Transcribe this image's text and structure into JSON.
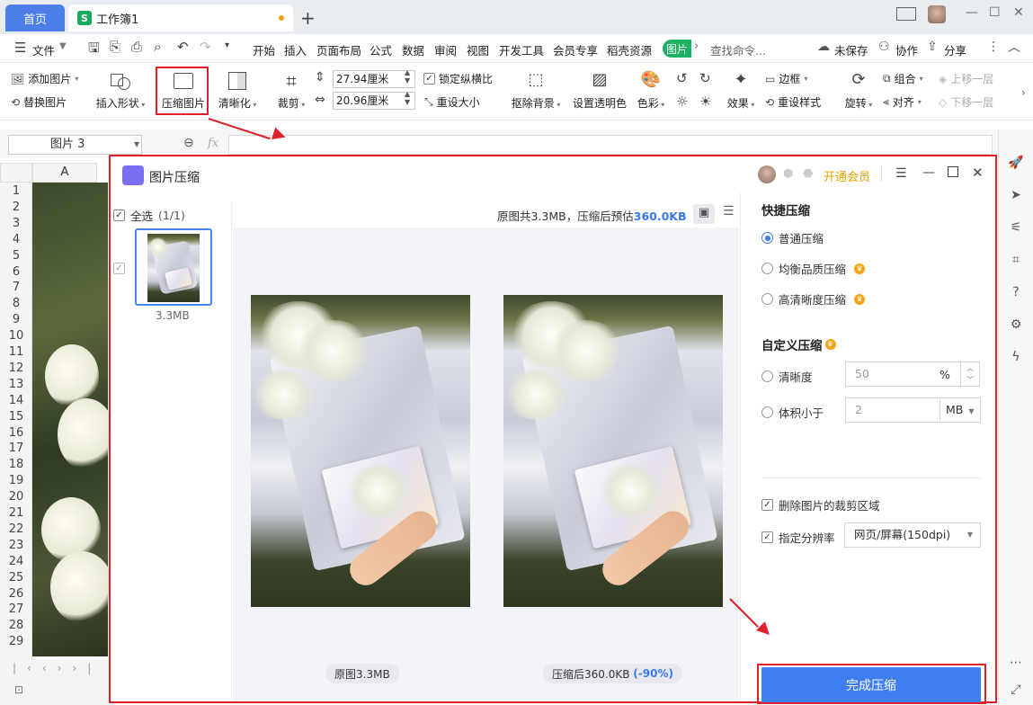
{
  "titlebar": {
    "home_tab": "首页",
    "doc_tab": "工作簿1",
    "doc_icon_letter": "S",
    "add_tab": "+",
    "minimize": "—",
    "maximize": "☐",
    "close": "✕"
  },
  "menubar": {
    "file": "文件",
    "items": [
      "开始",
      "插入",
      "页面布局",
      "公式",
      "数据",
      "审阅",
      "视图",
      "开发工具",
      "会员专享",
      "稻壳资源"
    ],
    "picture_tab": "图片",
    "search_placeholder": "查找命令...",
    "unsaved": "未保存",
    "collab": "协作",
    "share": "分享"
  },
  "ribbon": {
    "add_picture": "添加图片",
    "replace_picture": "替换图片",
    "insert_shape": "插入形状",
    "compress_picture": "压缩图片",
    "sharpen": "清晰化",
    "crop": "裁剪",
    "width_value": "27.94厘米",
    "height_value": "20.96厘米",
    "lock_ratio": "锁定纵横比",
    "reset_size": "重设大小",
    "remove_bg": "抠除背景",
    "set_transparent": "设置透明色",
    "color": "色彩",
    "effect": "效果",
    "border": "边框",
    "reset_style": "重设样式",
    "rotate": "旋转",
    "group": "组合",
    "align": "对齐",
    "bring_forward": "上移一层",
    "send_backward": "下移一层"
  },
  "formulabar": {
    "name_box": "图片 3",
    "fx": "fx"
  },
  "sheet": {
    "column_a": "A",
    "rows": [
      "1",
      "2",
      "3",
      "4",
      "5",
      "6",
      "7",
      "8",
      "9",
      "10",
      "11",
      "12",
      "13",
      "14",
      "15",
      "16",
      "17",
      "18",
      "19",
      "20",
      "21",
      "22",
      "23",
      "24",
      "25",
      "26",
      "27",
      "28",
      "29"
    ]
  },
  "dialog": {
    "title": "图片压缩",
    "vip": "开通会员",
    "select_all": "全选",
    "select_count": "(1/1)",
    "summary_prefix": "原图共3.3MB，压缩后预估",
    "summary_size": "360.0KB",
    "thumb_size": "3.3MB",
    "caption_original": "原图3.3MB",
    "caption_compressed": "压缩后360.0KB",
    "caption_ratio": "(-90%)",
    "quick_title": "快捷压缩",
    "opt_normal": "普通压缩",
    "opt_balanced": "均衡品质压缩",
    "opt_hd": "高清晰度压缩",
    "custom_title": "自定义压缩",
    "clarity_label": "清晰度",
    "clarity_value": "50",
    "clarity_unit": "%",
    "size_label": "体积小于",
    "size_value": "2",
    "size_unit": "MB",
    "delete_crop": "删除图片的裁剪区域",
    "set_resolution": "指定分辨率",
    "resolution_value": "网页/屏幕(150dpi)",
    "done": "完成压缩"
  }
}
